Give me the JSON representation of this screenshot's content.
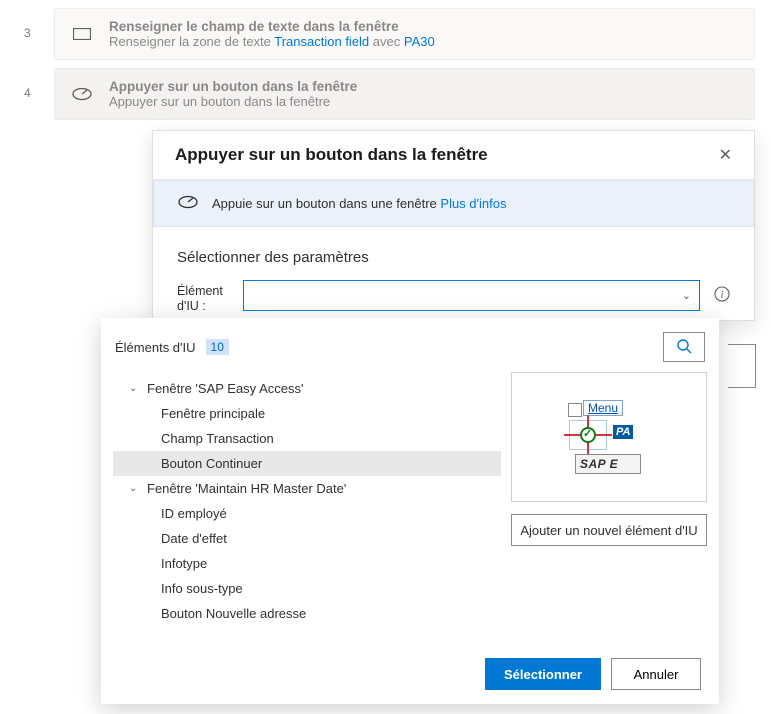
{
  "steps": [
    {
      "num": "3",
      "title": "Renseigner le champ de texte dans la fenêtre",
      "sub_prefix": "Renseigner la zone de texte ",
      "link": "Transaction field",
      "sub_mid": " avec ",
      "value": "PA30"
    },
    {
      "num": "4",
      "title": "Appuyer sur un bouton dans la fenêtre",
      "sub": "Appuyer sur un bouton dans la fenêtre"
    }
  ],
  "dialog": {
    "title": "Appuyer sur un bouton dans la fenêtre",
    "info_text": "Appuie sur un bouton dans une fenêtre ",
    "info_link": "Plus d'infos",
    "section_title": "Sélectionner des paramètres",
    "param_label": "Élément d'IU :"
  },
  "picker": {
    "title": "Éléments d'IU",
    "count": "10",
    "add_button": "Ajouter un nouvel élément d'IU",
    "select_btn": "Sélectionner",
    "cancel_btn": "Annuler",
    "tree": {
      "win1": "Fenêtre 'SAP Easy Access'",
      "win1_items": [
        "Fenêtre principale",
        "Champ Transaction",
        "Bouton Continuer"
      ],
      "win2": "Fenêtre 'Maintain HR Master Date'",
      "win2_items": [
        "ID employé",
        "Date d'effet",
        "Infotype",
        "Info sous-type",
        "Bouton Nouvelle adresse"
      ]
    },
    "preview": {
      "menu": "Menu",
      "pa": "PA",
      "sap": "SAP E"
    }
  }
}
